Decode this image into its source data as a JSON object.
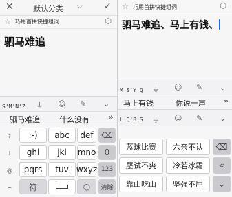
{
  "left": {
    "header": {
      "close_icon": "close-icon",
      "title": "默认分类",
      "dropdown_icon": "chevron-down-icon",
      "confirm_icon": "check-icon"
    },
    "tipbar": {
      "tip": "巧用首拼快捷组词"
    },
    "note_text": "驷马难追",
    "toolbar": {
      "pinyin": "S'M'N'Z",
      "icons": [
        "mic-icon",
        "emoji-icon",
        "attach-icon",
        "chevron-down-icon"
      ]
    },
    "candidates": [
      "驷马难追",
      "什么没有"
    ],
    "left_symbols": [
      "?",
      "!",
      "@",
      "~"
    ],
    "keys": [
      [
        ":-)",
        "abc",
        "def"
      ],
      [
        "ghi",
        "jkl",
        "mno"
      ],
      [
        "pqrs",
        "tuv",
        "wxyz"
      ]
    ],
    "right_keys": [
      "⌫",
      "0",
      "123",
      "清除"
    ],
    "bottom": {
      "symbol": "符",
      "space": "___",
      "settings": "○"
    }
  },
  "right": {
    "tipbar": {
      "tip": "巧用首拼快捷组词"
    },
    "note_text": "驷马难追、马上有钱、",
    "toolbar": {
      "pinyin": "M'S'Y'Q",
      "icons": [
        "mic-icon",
        "emoji-icon",
        "attach-icon",
        "chevron-down-icon"
      ]
    },
    "candidates1": [
      "马上有钱",
      "你说一声"
    ],
    "toolbar2": {
      "pinyin": "L'Q'B'S"
    },
    "phrases": [
      [
        "蓝球比赛",
        "六亲不认"
      ],
      [
        "屡试不爽",
        "冷若冰霜"
      ],
      [
        "靠山吃山",
        "坚强不屈"
      ]
    ],
    "right_keys": [
      "⌫",
      "«",
      "⌄"
    ]
  }
}
